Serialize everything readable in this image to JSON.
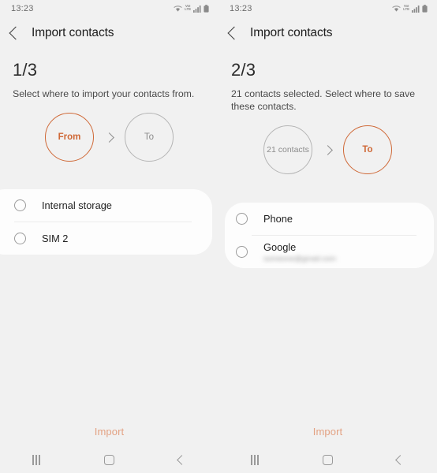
{
  "colors": {
    "accent": "#cf6836",
    "accent_faded": "#e3a283",
    "background": "#f1f1f1",
    "card": "#fdfdfd",
    "text_primary": "#1f1f1f",
    "text_secondary": "#4a4a4a",
    "inactive": "#8c8c8c"
  },
  "panels": [
    {
      "status_bar": {
        "time": "13:23",
        "icons": [
          "wifi-icon",
          "volte-icon",
          "signal-icon",
          "battery-icon"
        ],
        "volte_top": "VoI",
        "volte_bottom": "LTE"
      },
      "app_bar": {
        "back_label": "back-icon",
        "title": "Import contacts"
      },
      "step": {
        "count": "1/3",
        "description": "Select where to import your contacts from."
      },
      "circles": [
        {
          "label": "From",
          "state": "active"
        },
        {
          "label": "To",
          "state": "inactive"
        }
      ],
      "options": [
        {
          "label": "Internal storage",
          "sub": "",
          "selected": false
        },
        {
          "label": "SIM 2",
          "sub": "",
          "selected": false
        }
      ],
      "action": {
        "label": "Import",
        "enabled": false
      },
      "nav_bar": {
        "recents": "recents-icon",
        "home": "home-icon",
        "back": "back-icon"
      }
    },
    {
      "status_bar": {
        "time": "13:23",
        "icons": [
          "wifi-icon",
          "volte-icon",
          "signal-icon",
          "battery-icon"
        ],
        "volte_top": "VoI",
        "volte_bottom": "LTE"
      },
      "app_bar": {
        "back_label": "back-icon",
        "title": "Import contacts"
      },
      "step": {
        "count": "2/3",
        "description": "21 contacts selected. Select where to save these contacts."
      },
      "circles": [
        {
          "label": "21 contacts",
          "state": "inactive",
          "multiline": true
        },
        {
          "label": "To",
          "state": "active"
        }
      ],
      "options": [
        {
          "label": "Phone",
          "sub": "",
          "selected": false
        },
        {
          "label": "Google",
          "sub": "someone@gmail.com",
          "selected": false,
          "sub_redacted": true
        }
      ],
      "action": {
        "label": "Import",
        "enabled": false
      },
      "nav_bar": {
        "recents": "recents-icon",
        "home": "home-icon",
        "back": "back-icon"
      }
    }
  ]
}
